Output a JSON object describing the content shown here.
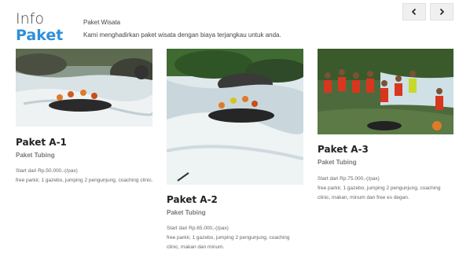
{
  "header": {
    "title_line1": "Info",
    "title_line2": "Paket",
    "section_label": "Paket Wisata",
    "description": "Kami menghadirkan paket wisata dengan biaya terjangkau untuk anda."
  },
  "nav": {
    "prev_icon": "chevron-left-icon",
    "next_icon": "chevron-right-icon"
  },
  "packages": [
    {
      "name": "Paket A-1",
      "type": "Paket Tubing",
      "price": "Start dari Rp.50.000,-(/pax)",
      "facilities": "free parkir, 1 gazebo, jumping 2 pengunjung, coaching clinic."
    },
    {
      "name": "Paket A-2",
      "type": "Paket Tubing",
      "price": "Start dari Rp.65.000,-(/pax)",
      "facilities": "free parkir, 1 gazebo, jumping 2 pengunjung, coaching clinic, makan dan minum."
    },
    {
      "name": "Paket A-3",
      "type": "Paket Tubing",
      "price": "Start dari Rp.75.000,-(/pax)",
      "facilities": "free parkir, 1 gazebo, jumping 2 pengunjung, coaching clinic, makan, minum dan free es degan."
    }
  ],
  "colors": {
    "accent": "#2f8fd8",
    "heading": "#222222",
    "muted": "#777777"
  }
}
